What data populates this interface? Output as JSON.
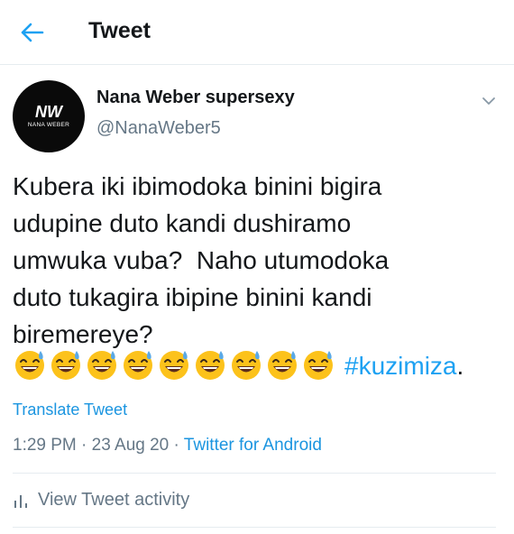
{
  "header": {
    "title": "Tweet"
  },
  "author": {
    "name": "Nana Weber supersexy",
    "handle": "@NanaWeber5",
    "avatar_logo": "NW",
    "avatar_text": "NANA WEBER"
  },
  "tweet": {
    "text": "Kubera iki ibimodoka binini bigira\nudupine duto kandi dushiramo\numwuka vuba?  Naho utumodoka\nduto tukagira ibipine binini kandi\nbiremereye?",
    "emoji_icon": "sweat-smile-emoji",
    "emoji_count": 9,
    "hashtag": "#kuzimiza",
    "trailing": "."
  },
  "translate_label": "Translate Tweet",
  "meta": {
    "time": "1:29 PM",
    "sep1": " · ",
    "date": "23 Aug 20",
    "sep2": " · ",
    "source": "Twitter for Android"
  },
  "activity_label": "View Tweet activity",
  "colors": {
    "accent": "#1da1f2",
    "text": "#14171a",
    "muted": "#657786",
    "divider": "#e6ecf0"
  }
}
